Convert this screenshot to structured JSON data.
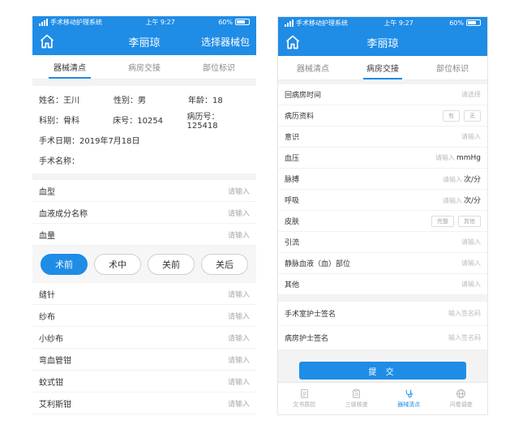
{
  "status": {
    "carrier": "手术移动护理系统",
    "time": "上午 9:27",
    "battery": "60%"
  },
  "left": {
    "title": "李丽琼",
    "action": "选择器械包",
    "tabs": [
      {
        "label": "器械清点",
        "active": true
      },
      {
        "label": "病房交接",
        "active": false
      },
      {
        "label": "部位标识",
        "active": false
      }
    ],
    "patient": {
      "name": "姓名：王川",
      "gender": "性别：男",
      "age": "年龄：18",
      "dept": "科别：骨科",
      "bed": "床号：10254",
      "record": "病历号：125418",
      "surgery_date": "手术日期：2019年7月18日",
      "surgery_name": "手术名称："
    },
    "blood_fields": [
      {
        "label": "血型",
        "placeholder": "请输入"
      },
      {
        "label": "血液成分名称",
        "placeholder": "请输入"
      },
      {
        "label": "血量",
        "placeholder": "请输入"
      }
    ],
    "phases": [
      {
        "label": "术前",
        "active": true
      },
      {
        "label": "术中",
        "active": false
      },
      {
        "label": "关前",
        "active": false
      },
      {
        "label": "关后",
        "active": false
      }
    ],
    "instruments": [
      {
        "label": "缝针",
        "placeholder": "请输入"
      },
      {
        "label": "纱布",
        "placeholder": "请输入"
      },
      {
        "label": "小纱布",
        "placeholder": "请输入"
      },
      {
        "label": "弯血管钳",
        "placeholder": "请输入"
      },
      {
        "label": "蚊式钳",
        "placeholder": "请输入"
      },
      {
        "label": "艾利斯钳",
        "placeholder": "请输入"
      }
    ]
  },
  "right": {
    "title": "李丽琼",
    "tabs": [
      {
        "label": "器械清点",
        "active": false
      },
      {
        "label": "病房交接",
        "active": true
      },
      {
        "label": "部位标识",
        "active": false
      }
    ],
    "fields": {
      "return_time": {
        "label": "回病房时间",
        "placeholder": "请选择"
      },
      "records": {
        "label": "病历资料",
        "opt1": "有",
        "opt2": "无"
      },
      "consciousness": {
        "label": "意识",
        "placeholder": "请输入"
      },
      "bp": {
        "label": "血压",
        "placeholder": "请输入",
        "unit": "mmHg"
      },
      "pulse": {
        "label": "脉搏",
        "placeholder": "请输入",
        "unit": "次/分"
      },
      "resp": {
        "label": "呼吸",
        "placeholder": "请输入",
        "unit": "次/分"
      },
      "skin": {
        "label": "皮肤",
        "opt1": "完整",
        "opt2": "其他"
      },
      "drainage": {
        "label": "引流",
        "placeholder": "请输入"
      },
      "iv_site": {
        "label": "静脉血液（血）部位",
        "placeholder": "请输入"
      },
      "other": {
        "label": "其他",
        "placeholder": "请输入"
      }
    },
    "signatures": [
      {
        "label": "手术室护士签名",
        "placeholder": "输入签名码"
      },
      {
        "label": "病房护士签名",
        "placeholder": "输入签名码"
      }
    ],
    "submit": "提 交",
    "bottom_nav": [
      {
        "label": "文书质控",
        "icon": "document-icon",
        "active": false
      },
      {
        "label": "三级核查",
        "icon": "checklist-icon",
        "active": false
      },
      {
        "label": "器械清点",
        "icon": "stethoscope-icon",
        "active": true
      },
      {
        "label": "问卷调查",
        "icon": "globe-icon",
        "active": false
      }
    ]
  },
  "colors": {
    "primary": "#1f8ce6",
    "placeholder": "#aaaaaa",
    "divider": "#f3f3f3"
  }
}
